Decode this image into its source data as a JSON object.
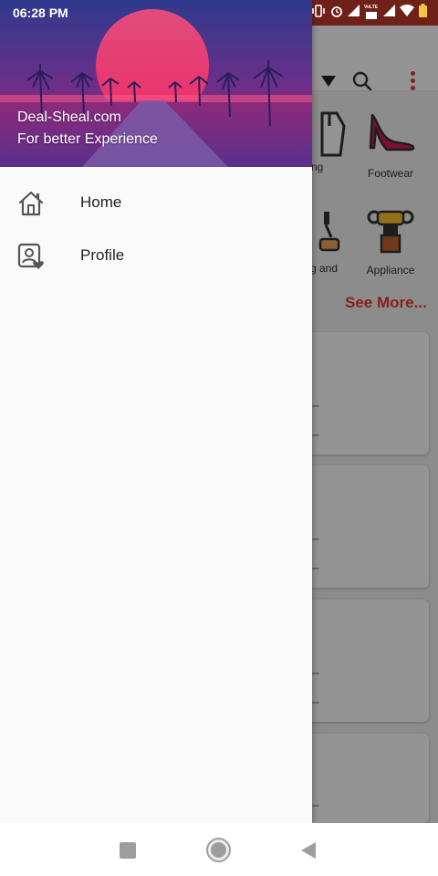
{
  "status_bar": {
    "time": "06:28 PM",
    "icons": [
      "vibrate-icon",
      "alarm-icon",
      "signal-icon",
      "volte-icon",
      "signal-icon-2",
      "wifi-icon",
      "battery-icon"
    ],
    "volte_text": "VoLTE"
  },
  "drawer": {
    "header": {
      "title": "Deal-Sheal.com",
      "subtitle": "For better Experience"
    },
    "items": [
      {
        "label": "Home",
        "icon": "home-icon"
      },
      {
        "label": "Profile",
        "icon": "profile-icon"
      }
    ]
  },
  "background_app": {
    "categories": [
      {
        "label": "ng",
        "icon": "clothing-icon"
      },
      {
        "label": "Footwear",
        "icon": "high-heel-icon"
      },
      {
        "label": "g and",
        "icon": "home-kitchen-icon"
      },
      {
        "label": "Appliance",
        "icon": "appliance-icon"
      }
    ],
    "see_more": "See More...",
    "accent_color": "#e53935"
  },
  "nav_bar": {
    "recent": "recent-apps-icon",
    "home": "home-circle-icon",
    "back": "back-triangle-icon"
  },
  "colors": {
    "status_bar": "#c0392b",
    "drawer_bg": "#fafafa",
    "header_gradient_top": "#2e3a8c",
    "header_gradient_bottom": "#c2185b"
  }
}
